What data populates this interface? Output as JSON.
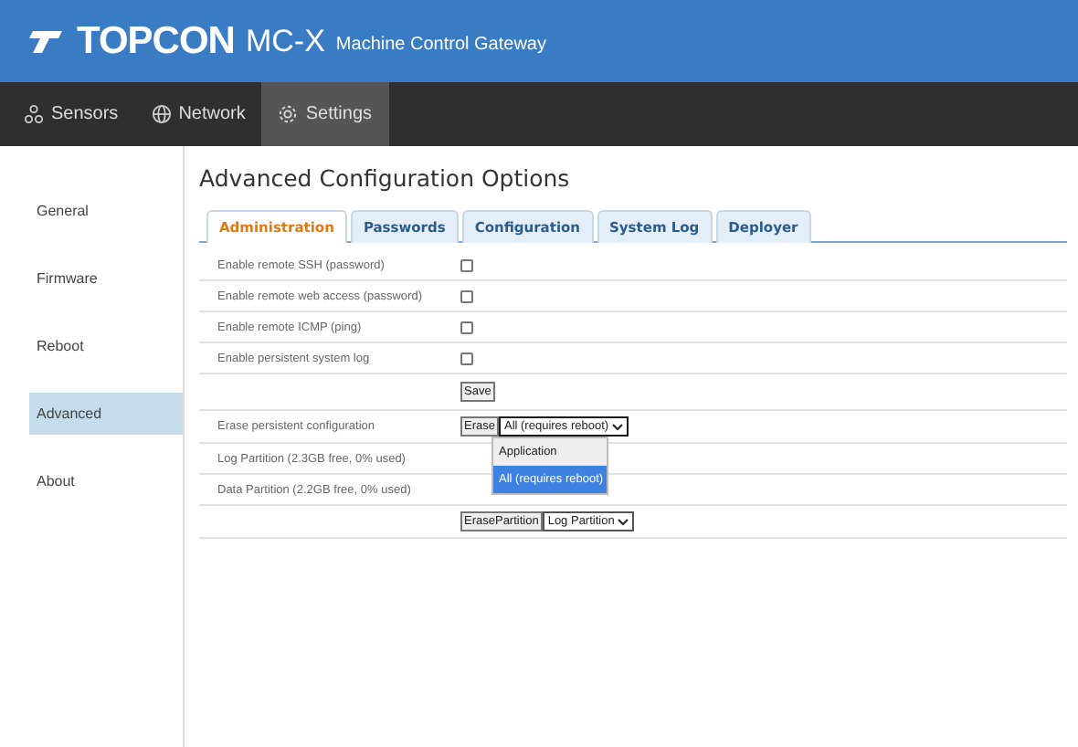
{
  "header": {
    "brand": "TOPCON",
    "product": "MC-X",
    "subtitle": "Machine Control Gateway"
  },
  "nav": [
    {
      "label": "Sensors",
      "selected": false
    },
    {
      "label": "Network",
      "selected": false
    },
    {
      "label": "Settings",
      "selected": true
    }
  ],
  "sidebar": {
    "items": [
      {
        "label": "General",
        "selected": false
      },
      {
        "label": "Firmware",
        "selected": false
      },
      {
        "label": "Reboot",
        "selected": false
      },
      {
        "label": "Advanced",
        "selected": true
      },
      {
        "label": "About",
        "selected": false
      }
    ]
  },
  "title": "Advanced Configuration Options",
  "tabs": [
    {
      "label": "Administration",
      "selected": true
    },
    {
      "label": "Passwords",
      "selected": false
    },
    {
      "label": "Configuration",
      "selected": false
    },
    {
      "label": "System Log",
      "selected": false
    },
    {
      "label": "Deployer",
      "selected": false
    }
  ],
  "rows": [
    {
      "kind": "checkbox",
      "label": "Enable remote SSH (password)",
      "checked": false
    },
    {
      "kind": "checkbox",
      "label": "Enable remote web access (password)",
      "checked": false
    },
    {
      "kind": "checkbox",
      "label": "Enable remote ICMP (ping)",
      "checked": false
    },
    {
      "kind": "checkbox",
      "label": "Enable persistent system log",
      "checked": false
    },
    {
      "kind": "button",
      "button": "Save"
    },
    {
      "kind": "select",
      "label": "Erase persistent configuration",
      "button": "Erase",
      "value": "All (requires reboot)",
      "expanded": true,
      "options": [
        {
          "label": "Application",
          "selected": false
        },
        {
          "label": "All (requires reboot)",
          "selected": true
        }
      ]
    },
    {
      "kind": "info",
      "label": "Log Partition (2.3GB free, 0% used)"
    },
    {
      "kind": "info",
      "label": "Data Partition (2.2GB free, 0% used)"
    },
    {
      "kind": "select",
      "button": "ErasePartition",
      "value": "Log Partition"
    }
  ]
}
